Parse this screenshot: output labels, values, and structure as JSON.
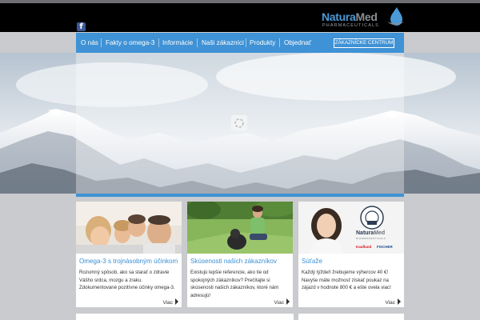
{
  "header": {
    "facebook_letter": "f",
    "logo": {
      "name_part1": "Natura",
      "name_part2": "Med",
      "tagline": "PHARMACEUTICALS"
    }
  },
  "nav": {
    "items": [
      "O nás",
      "Fakty o omega-3",
      "Informácie",
      "Naši zákazníci",
      "Produkty",
      "Objednať"
    ],
    "customer_center": "ZÁKAZNÍCKE CENTRUM"
  },
  "cards": [
    {
      "title": "Omega-3 s trojnásobným účinkom",
      "text": "Rozumný spôsob, ako sa starať o zdravie Vášho srdca, mozgu a zraku. Zdokumentované pozitívne účinky omega-3.",
      "more": "Viac"
    },
    {
      "title": "Skúsenosti našich zákazníkov",
      "text": "Existujú lepšie referencie, ako tie od spokojných zákazníkov? Prečítajte si skúsenosti našich zákazníkov, ktoré nám adresujú!",
      "more": "Viac"
    },
    {
      "title": "Súťaže",
      "text": "Každý týždeň žrebujeme výhercov 40 €! Navyše máte možnosť získať poukaz na zájazd v hodnote 800 € a ešte ovela viac!",
      "more": "Viac"
    }
  ],
  "card3_logo": {
    "name_part1": "Natura",
    "name_part2": "Med",
    "tagline": "PHARMACEUTICALS",
    "partner1": "Kaufland",
    "partner2": "FISCHER"
  },
  "colors": {
    "accent": "#3f92d5",
    "header": "#000000",
    "page": "#c9cbce"
  }
}
